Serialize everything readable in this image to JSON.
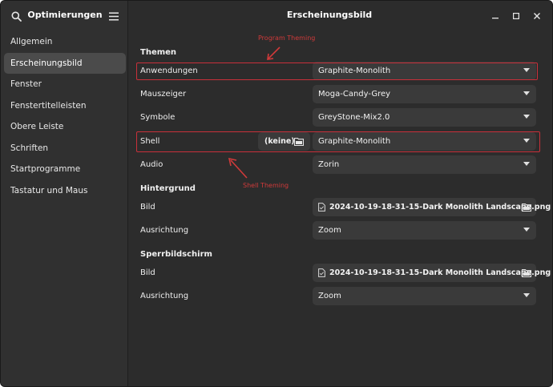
{
  "sidebar": {
    "title": "Optimierungen",
    "items": [
      {
        "label": "Allgemein"
      },
      {
        "label": "Erscheinungsbild"
      },
      {
        "label": "Fenster"
      },
      {
        "label": "Fenstertitelleisten"
      },
      {
        "label": "Obere Leiste"
      },
      {
        "label": "Schriften"
      },
      {
        "label": "Startprogramme"
      },
      {
        "label": "Tastatur und Maus"
      }
    ],
    "active_index": 1
  },
  "header": {
    "title": "Erscheinungsbild"
  },
  "themen": {
    "title": "Themen",
    "anwendungen": {
      "label": "Anwendungen",
      "value": "Graphite-Monolith"
    },
    "mauszeiger": {
      "label": "Mauszeiger",
      "value": "Moga-Candy-Grey"
    },
    "symbole": {
      "label": "Symbole",
      "value": "GreyStone-Mix2.0"
    },
    "shell": {
      "label": "Shell",
      "file_value": "(keine)",
      "value": "Graphite-Monolith"
    },
    "audio": {
      "label": "Audio",
      "value": "Zorin"
    }
  },
  "hintergrund": {
    "title": "Hintergrund",
    "bild": {
      "label": "Bild",
      "value": "2024-10-19-18-31-15-Dark Monolith Landscape.png"
    },
    "ausrichtung": {
      "label": "Ausrichtung",
      "value": "Zoom"
    }
  },
  "sperrbildschirm": {
    "title": "Sperrbildschirm",
    "bild": {
      "label": "Bild",
      "value": "2024-10-19-18-31-15-Dark Monolith Landscape.png"
    },
    "ausrichtung": {
      "label": "Ausrichtung",
      "value": "Zoom"
    }
  },
  "annotations": {
    "program": "Program Theming",
    "shell": "Shell Theming"
  },
  "icons": {
    "search": "search-icon",
    "menu": "hamburger-menu-icon",
    "minimize": "minimize-icon",
    "maximize": "maximize-icon",
    "close": "close-icon",
    "file": "file-icon",
    "folder": "folder-open-icon"
  },
  "colors": {
    "window_bg": "#2c2c2c",
    "sidebar_bg": "#303030",
    "active_item": "#4b4b4b",
    "combo_bg": "#3a3a3a",
    "highlight": "#c8303a"
  }
}
